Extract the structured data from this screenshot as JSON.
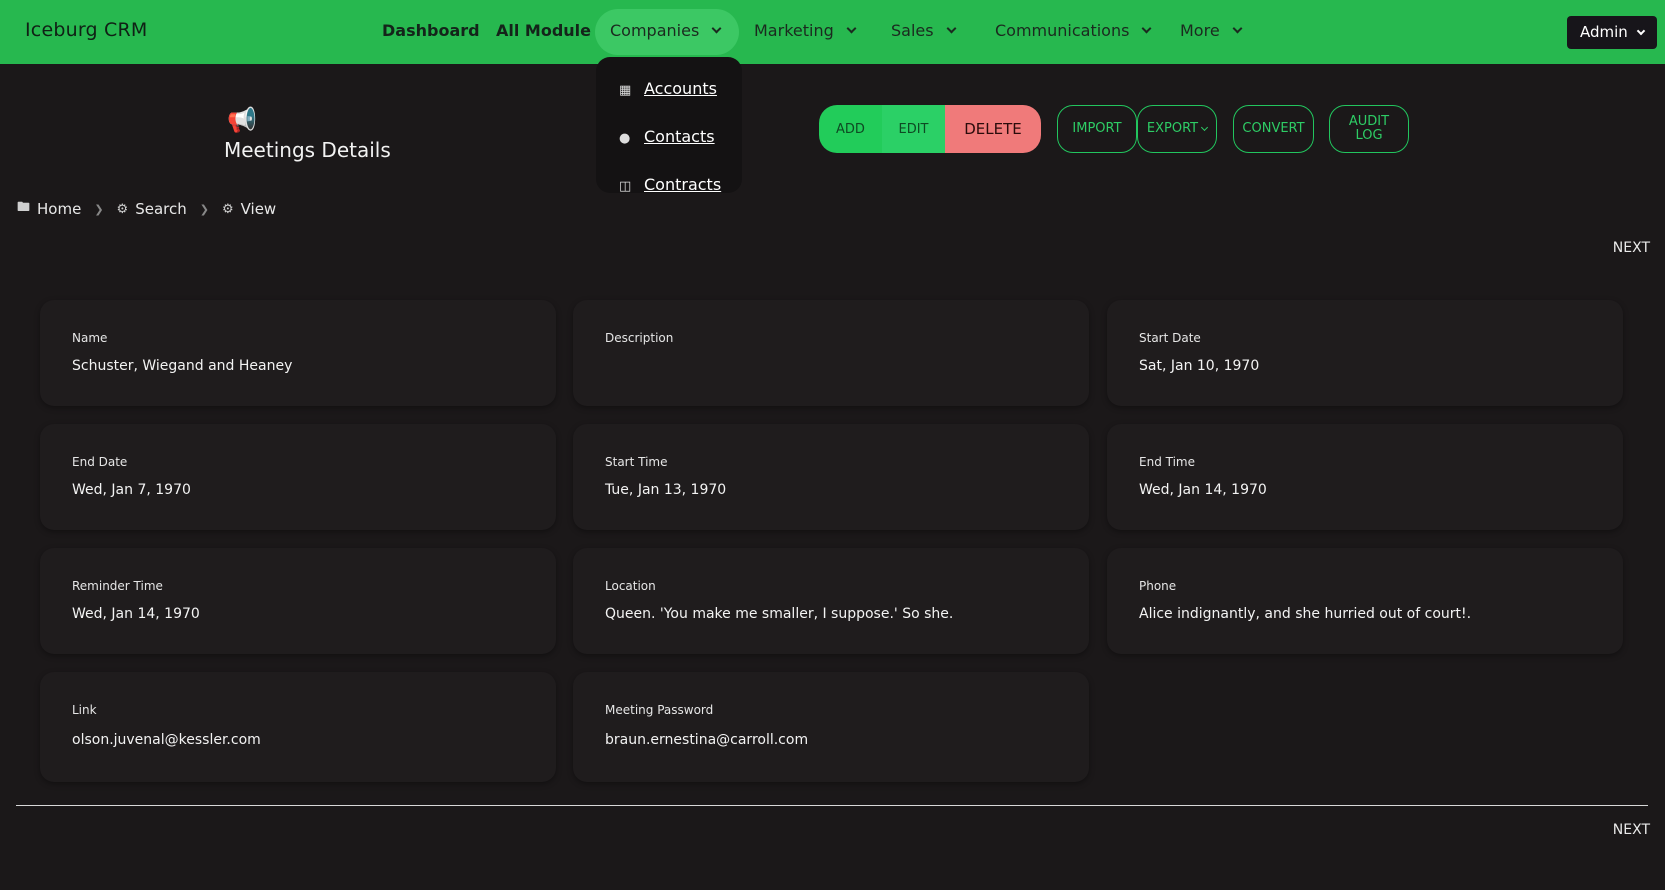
{
  "app": {
    "brand": "Iceburg CRM"
  },
  "nav": {
    "items": [
      {
        "label": "Dashboard"
      },
      {
        "label": "All Module"
      },
      {
        "label": "Companies"
      },
      {
        "label": "Marketing"
      },
      {
        "label": "Sales"
      },
      {
        "label": "Communications"
      },
      {
        "label": "More"
      }
    ],
    "user": "Admin"
  },
  "companies_menu": {
    "items": [
      {
        "label": "Accounts",
        "icon": "building-icon"
      },
      {
        "label": "Contacts",
        "icon": "person-icon"
      },
      {
        "label": "Contracts",
        "icon": "book-icon"
      }
    ]
  },
  "page": {
    "title": "Meetings Details",
    "icon": "megaphone-icon"
  },
  "actions": {
    "add": "ADD",
    "edit": "EDIT",
    "delete": "DELETE",
    "import": "IMPORT",
    "export": "EXPORT",
    "convert": "CONVERT",
    "audit_log": "AUDIT LOG"
  },
  "breadcrumb": {
    "home": "Home",
    "search": "Search",
    "view": "View"
  },
  "pager": {
    "next": "NEXT"
  },
  "fields": [
    {
      "label": "Name",
      "value": "Schuster, Wiegand and Heaney"
    },
    {
      "label": "Description",
      "value": ""
    },
    {
      "label": "Start Date",
      "value": "Sat, Jan 10, 1970"
    },
    {
      "label": "End Date",
      "value": "Wed, Jan 7, 1970"
    },
    {
      "label": "Start Time",
      "value": "Tue, Jan 13, 1970"
    },
    {
      "label": "End Time",
      "value": "Wed, Jan 14, 1970"
    },
    {
      "label": "Reminder Time",
      "value": "Wed, Jan 14, 1970"
    },
    {
      "label": "Location",
      "value": "Queen. 'You make me smaller, I suppose.' So she."
    },
    {
      "label": "Phone",
      "value": "Alice indignantly, and she hurried out of court!."
    },
    {
      "label": "Link",
      "value": "olson.juvenal@kessler.com"
    },
    {
      "label": "Meeting Password",
      "value": "braun.ernestina@carroll.com"
    }
  ],
  "colors": {
    "topbar": "#27b84f",
    "background": "#1b1819",
    "card": "#1f1c1d",
    "delete": "#f07a7a",
    "accent": "#22c55e"
  }
}
